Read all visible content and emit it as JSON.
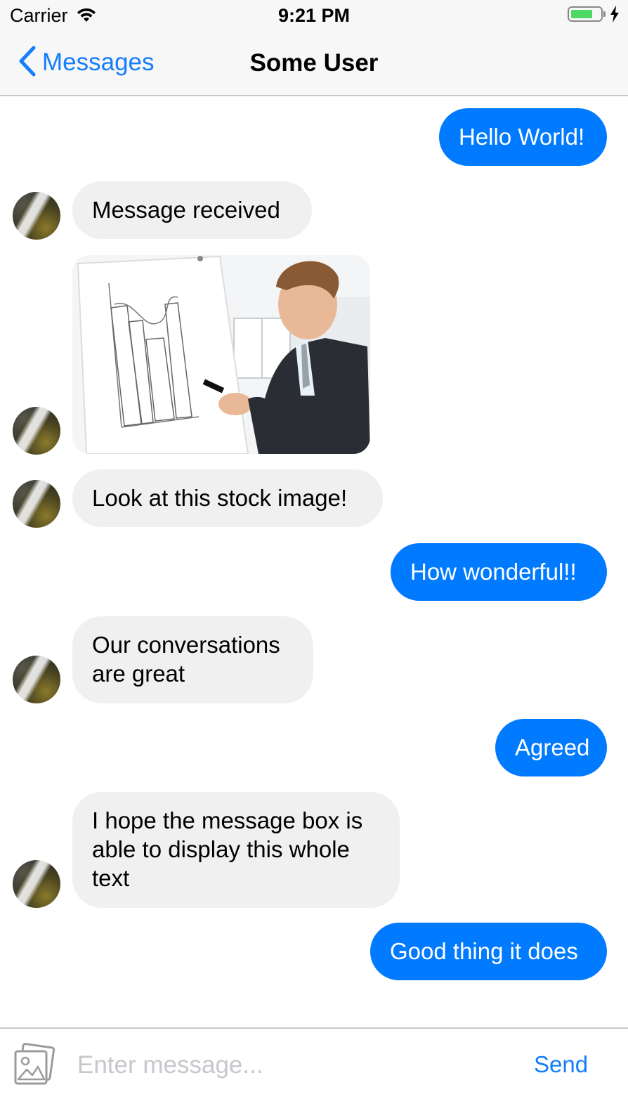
{
  "status_bar": {
    "carrier": "Carrier",
    "time": "9:21 PM",
    "battery_level": 0.75,
    "icons": [
      "wifi-icon",
      "battery-icon",
      "charging-bolt-icon"
    ]
  },
  "nav": {
    "back_label": "Messages",
    "title": "Some User"
  },
  "colors": {
    "accent": "#147efb",
    "outgoing_bubble": "#007aff",
    "incoming_bubble": "#f0f0f0"
  },
  "messages": [
    {
      "direction": "outgoing",
      "text": "Hello World!"
    },
    {
      "direction": "incoming",
      "text": "Message received"
    },
    {
      "direction": "incoming",
      "type": "image",
      "image": "stock-photo-businessman-at-whiteboard"
    },
    {
      "direction": "incoming",
      "text": "Look at this stock image!"
    },
    {
      "direction": "outgoing",
      "text": "How wonderful!!"
    },
    {
      "direction": "incoming",
      "text": "Our conversations are great"
    },
    {
      "direction": "outgoing",
      "text": "Agreed"
    },
    {
      "direction": "incoming",
      "text": "I hope the message box is able to display this whole text"
    },
    {
      "direction": "outgoing",
      "text": "Good thing it does"
    }
  ],
  "composer": {
    "placeholder": "Enter message...",
    "value": "",
    "send_label": "Send",
    "photo_icon": "photo-icon"
  }
}
